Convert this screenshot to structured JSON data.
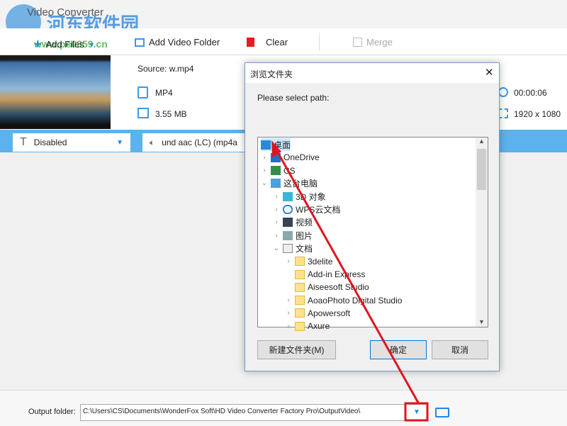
{
  "app": {
    "title": "Video Converter",
    "watermark": "河东软件园 www.pc0359.cn"
  },
  "toolbar": {
    "add_files": "Add Files",
    "add_video_folder": "Add Video Folder",
    "clear": "Clear",
    "merge": "Merge"
  },
  "file": {
    "source": "Source: w.mp4",
    "format": "MP4",
    "size": "3.55 MB",
    "duration": "00:00:06",
    "resolution": "1920 x 1080"
  },
  "options": {
    "subtitle": "Disabled",
    "audio": "und aac (LC) (mp4a"
  },
  "output": {
    "label": "Output folder:",
    "path": "C:\\Users\\CS\\Documents\\WonderFox Soft\\HD Video Converter Factory Pro\\OutputVideo\\"
  },
  "dialog": {
    "title": "浏览文件夹",
    "prompt": "Please select path:",
    "new_folder": "新建文件夹(M)",
    "ok": "确定",
    "cancel": "取消",
    "tree": [
      {
        "label": "桌面",
        "level": 0,
        "chev": "",
        "icon": "desktop",
        "selected": true
      },
      {
        "label": "OneDrive",
        "level": 0,
        "chev": ">",
        "icon": "cloud"
      },
      {
        "label": "CS",
        "level": 0,
        "chev": ">",
        "icon": "user"
      },
      {
        "label": "这台电脑",
        "level": 0,
        "chev": "v",
        "icon": "computer"
      },
      {
        "label": "3D 对象",
        "level": 1,
        "chev": ">",
        "icon": "cube"
      },
      {
        "label": "WPS云文档",
        "level": 1,
        "chev": ">",
        "icon": "cloud-outline"
      },
      {
        "label": "视频",
        "level": 1,
        "chev": ">",
        "icon": "video"
      },
      {
        "label": "图片",
        "level": 1,
        "chev": ">",
        "icon": "picture"
      },
      {
        "label": "文档",
        "level": 1,
        "chev": "v",
        "icon": "document"
      },
      {
        "label": "3delite",
        "level": 2,
        "chev": ">",
        "icon": "folder"
      },
      {
        "label": "Add-in Express",
        "level": 2,
        "chev": "",
        "icon": "folder"
      },
      {
        "label": "Aiseesoft Studio",
        "level": 2,
        "chev": "",
        "icon": "folder"
      },
      {
        "label": "AoaoPhoto Digital Studio",
        "level": 2,
        "chev": ">",
        "icon": "folder"
      },
      {
        "label": "Apowersoft",
        "level": 2,
        "chev": ">",
        "icon": "folder"
      },
      {
        "label": "Axure",
        "level": 2,
        "chev": ">",
        "icon": "folder"
      }
    ]
  },
  "colors": {
    "accent": "#5cb2ec",
    "annotation": "#e0141e"
  }
}
